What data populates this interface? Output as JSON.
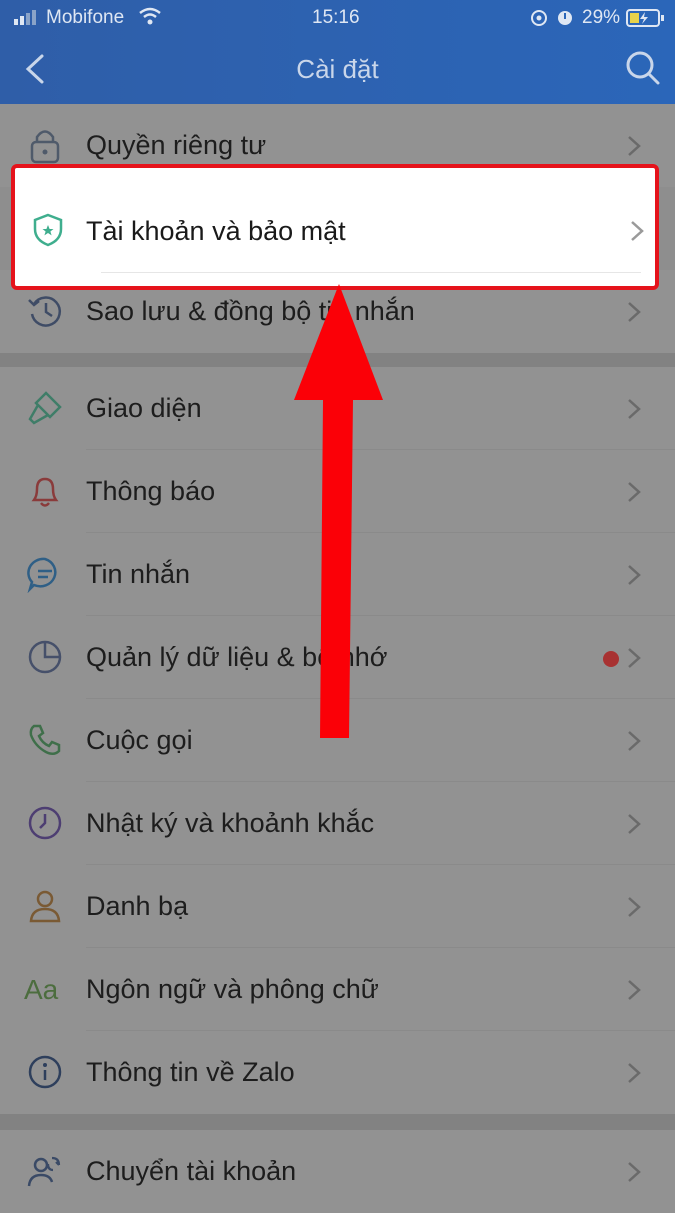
{
  "status_bar": {
    "carrier": "Mobifone",
    "time": "15:16",
    "battery": "29%"
  },
  "header": {
    "title": "Cài đặt"
  },
  "items": [
    {
      "label": "Quyền riêng tư",
      "icon": "lock-icon"
    },
    {
      "label": "Tài khoản và bảo mật",
      "icon": "shield-icon"
    },
    {
      "label": "Sao lưu & đồng bộ tin nhắn",
      "icon": "history-icon"
    },
    {
      "label": "Giao diện",
      "icon": "paint-brush-icon"
    },
    {
      "label": "Thông báo",
      "icon": "bell-icon"
    },
    {
      "label": "Tin nhắn",
      "icon": "chat-bubble-icon"
    },
    {
      "label": "Quản lý dữ liệu & bộ nhớ",
      "icon": "pie-chart-icon"
    },
    {
      "label": "Cuộc gọi",
      "icon": "phone-icon"
    },
    {
      "label": "Nhật ký và khoảnh khắc",
      "icon": "clock-icon"
    },
    {
      "label": "Danh bạ",
      "icon": "person-icon"
    },
    {
      "label": "Ngôn ngữ và phông chữ",
      "icon": "font-aa-icon",
      "icon_text": "Aa"
    },
    {
      "label": "Thông tin về Zalo",
      "icon": "info-icon"
    },
    {
      "label": "Chuyển tài khoản",
      "icon": "switch-account-icon"
    }
  ],
  "colors": {
    "header": "#2b66b9",
    "highlight_border": "#e5131b",
    "arrow": "#fb0007",
    "badge_dot": "#a83232"
  }
}
